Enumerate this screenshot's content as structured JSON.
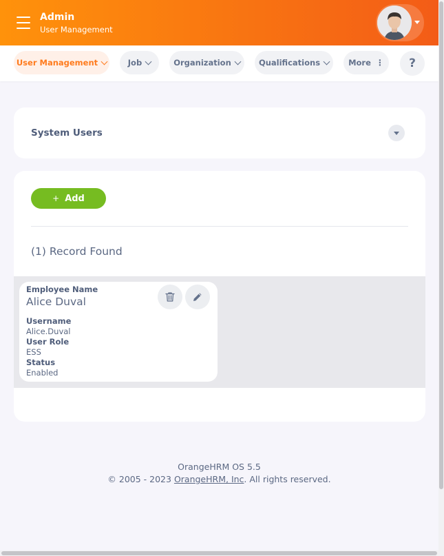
{
  "header": {
    "title": "Admin",
    "subtitle": "User Management",
    "menu_icon": "hamburger-menu-icon",
    "avatar_icon": "user-avatar"
  },
  "nav": {
    "items": [
      {
        "label": "User Management",
        "active": true
      },
      {
        "label": "Job"
      },
      {
        "label": "Organization"
      },
      {
        "label": "Qualifications"
      },
      {
        "label": "More"
      }
    ],
    "help_label": "?"
  },
  "filter": {
    "title": "System Users"
  },
  "list": {
    "add_icon": "+",
    "add_label": "Add",
    "records_found": "(1) Record Found",
    "rows": [
      {
        "employee_name_label": "Employee Name",
        "employee_name": "Alice Duval",
        "username_label": "Username",
        "username": "Alice.Duval",
        "user_role_label": "User Role",
        "user_role": "ESS",
        "status_label": "Status",
        "status": "Enabled"
      }
    ]
  },
  "footer": {
    "version": "OrangeHRM OS 5.5",
    "copyright_prefix": "© 2005 - 2023 ",
    "company_link": "OrangeHRM, Inc",
    "copyright_suffix": ". All rights reserved."
  },
  "colors": {
    "header_gradient_start": "#ff920b",
    "header_gradient_end": "#f35c17",
    "active_tab": "#ff7b1d",
    "add_button": "#76bc21"
  }
}
